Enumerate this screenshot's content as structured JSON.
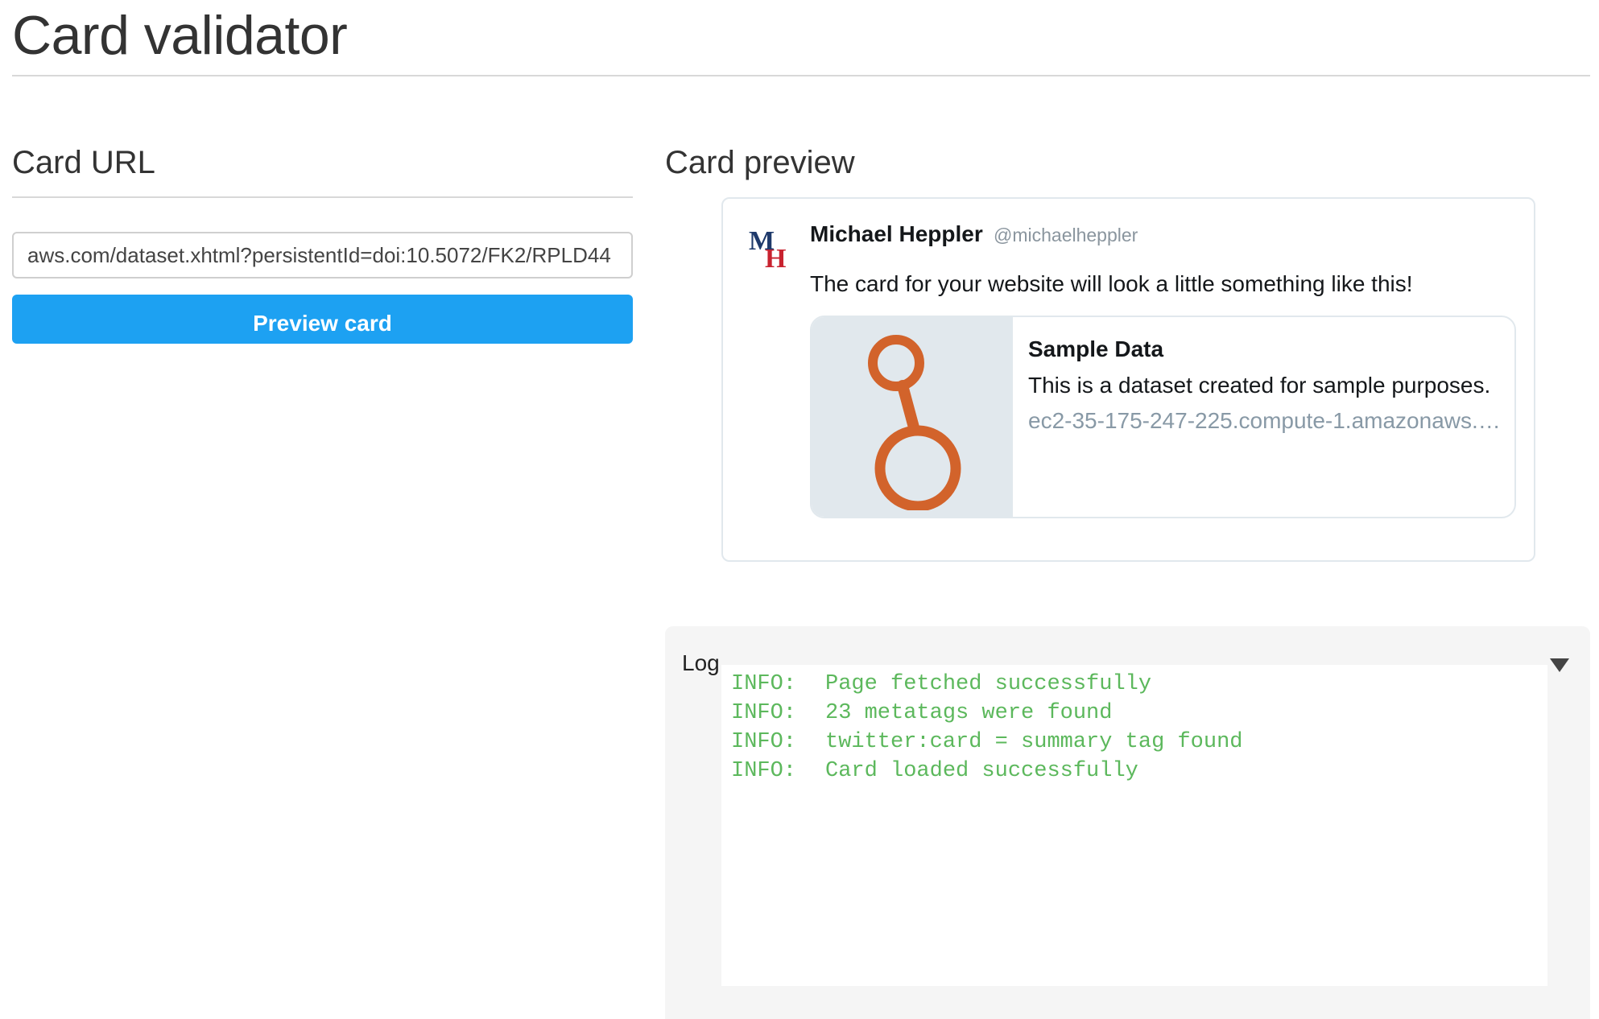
{
  "page": {
    "title": "Card validator"
  },
  "url_section": {
    "heading": "Card URL",
    "input_value": "aws.com/dataset.xhtml?persistentId=doi:10.5072/FK2/RPLD44",
    "button_label": "Preview card"
  },
  "preview_section": {
    "heading": "Card preview",
    "tweet": {
      "avatar_initials": "MH",
      "author_name": "Michael Heppler",
      "author_handle": "@michaelheppler",
      "text": "The card for your website will look a little something like this!",
      "card": {
        "thumbnail_icon": "key-ring-icon",
        "title": "Sample Data",
        "description": "This is a dataset created for sample purposes.",
        "domain": "ec2-35-175-247-225.compute-1.amazonaws.com"
      }
    }
  },
  "log": {
    "label": "Log",
    "toggle_icon": "triangle-down-icon",
    "entries": [
      {
        "level": "INFO:",
        "message": "Page fetched successfully"
      },
      {
        "level": "INFO:",
        "message": "23 metatags were found"
      },
      {
        "level": "INFO:",
        "message": "twitter:card = summary tag found"
      },
      {
        "level": "INFO:",
        "message": "Card loaded successfully"
      }
    ]
  },
  "colors": {
    "button_bg": "#1da1f2",
    "log_text": "#5cb85c",
    "card_thumb_bg": "#e1e8ed",
    "icon_orange": "#d2632b",
    "avatar_blue": "#1f3a6b",
    "avatar_red": "#c8222f"
  }
}
